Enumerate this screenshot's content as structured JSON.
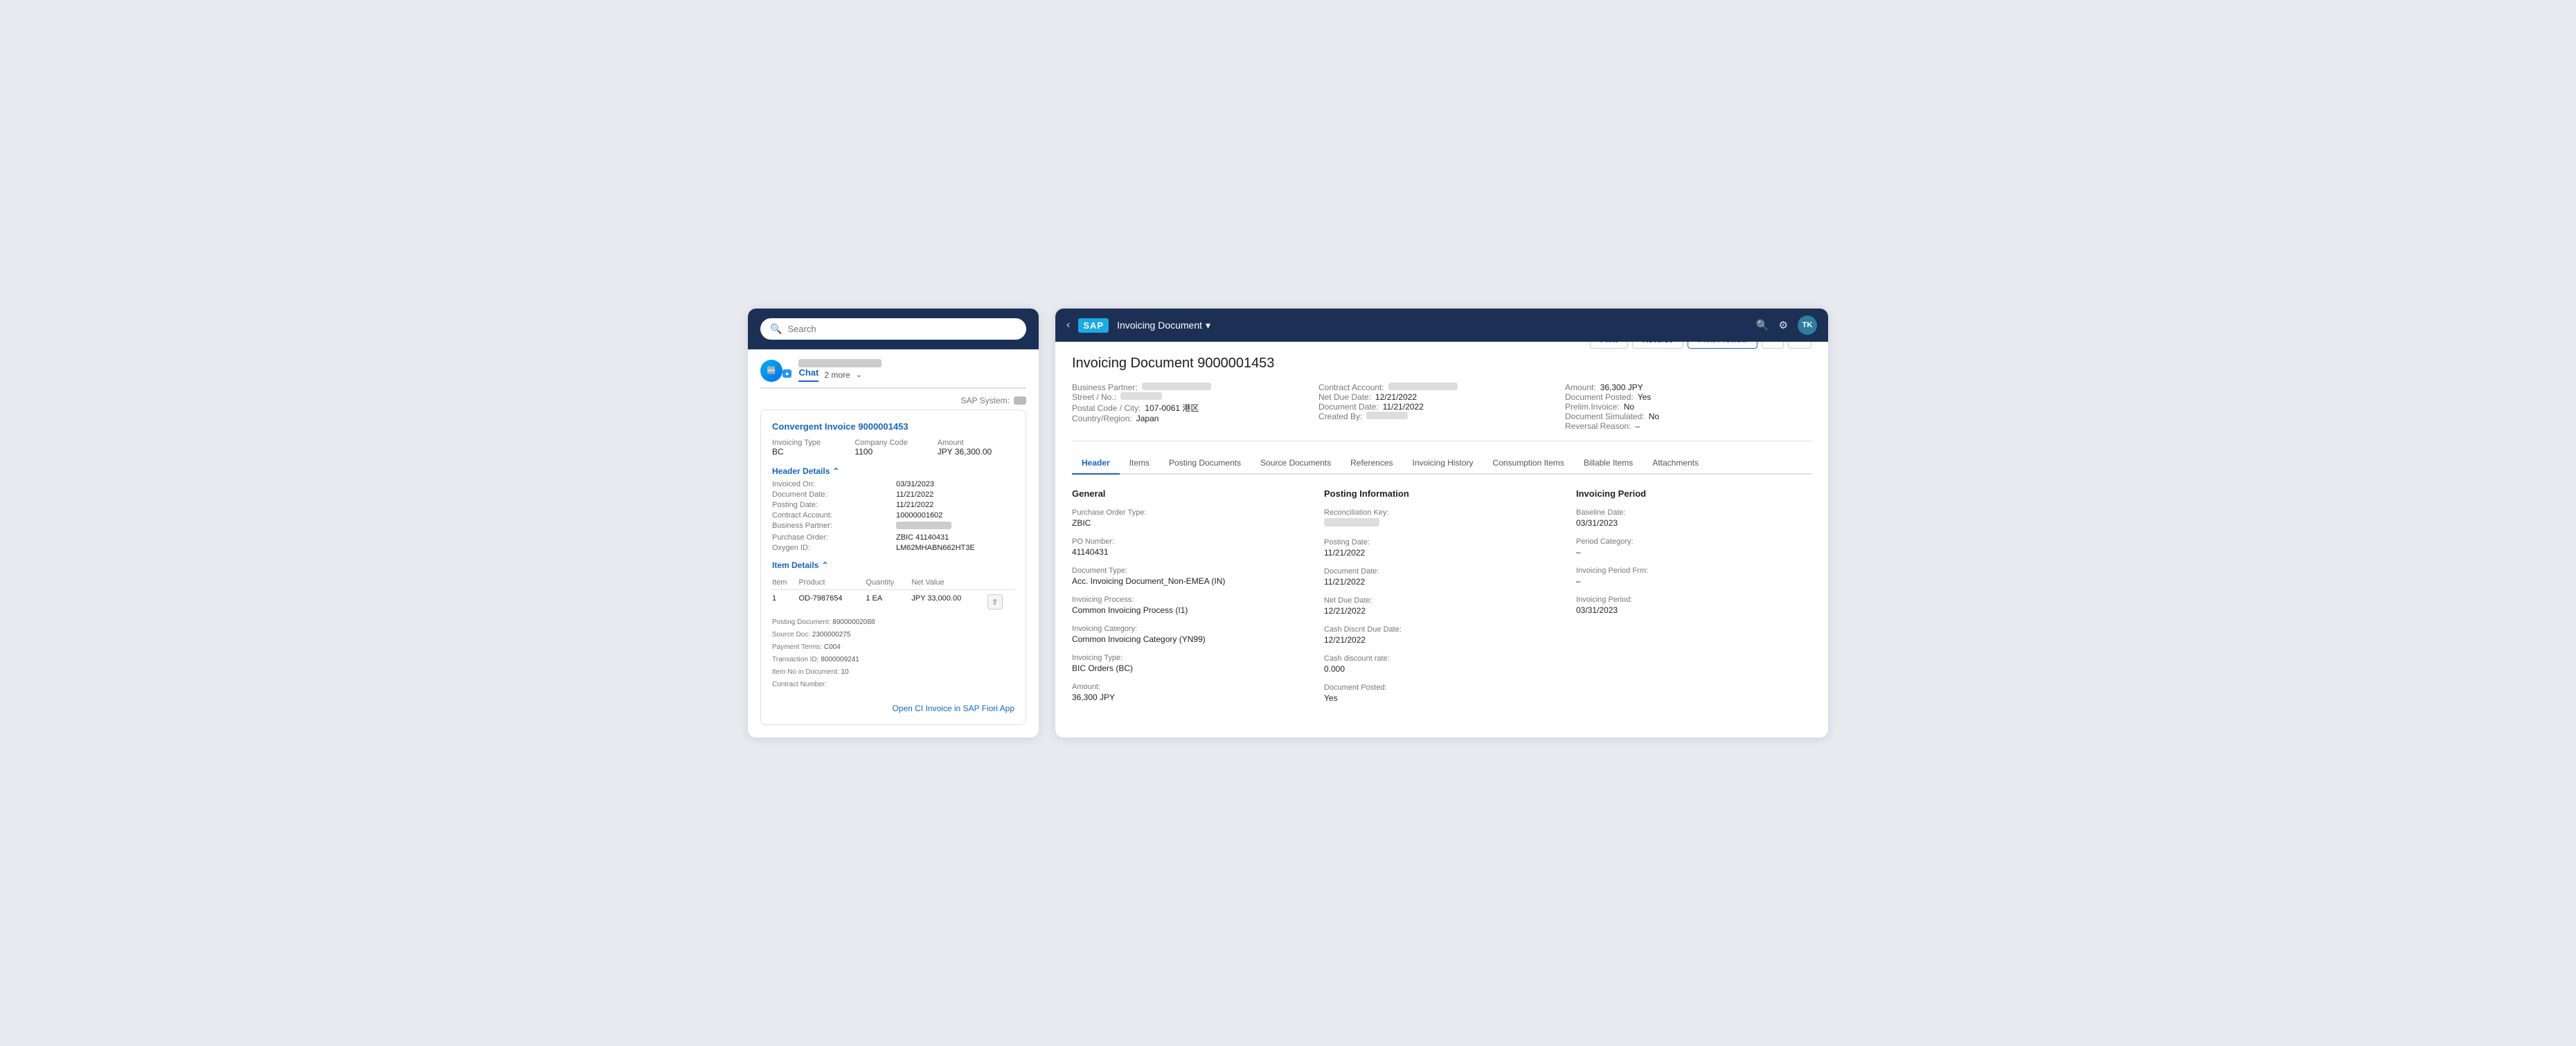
{
  "leftPanel": {
    "searchPlaceholder": "Search",
    "chatLabel": "Chat",
    "moreLabel": "2 more",
    "sapSystemLabel": "SAP System:",
    "invoiceLink": "Convergent Invoice 9000001453",
    "invoiceMeta": {
      "invTypeLabel": "Invoicing Type",
      "invTypeValue": "BC",
      "companyCodeLabel": "Company Code",
      "companyCodeValue": "1100",
      "amountLabel": "Amount",
      "amountValue": "JPY 36,300.00"
    },
    "headerDetails": {
      "sectionTitle": "Header Details",
      "fields": [
        {
          "label": "Invoiced On:",
          "value": "03/31/2023"
        },
        {
          "label": "Document Date:",
          "value": "11/21/2022"
        },
        {
          "label": "Posting Date:",
          "value": "11/21/2022"
        },
        {
          "label": "Contract Account:",
          "value": "10000001602"
        },
        {
          "label": "Business Partner:",
          "value": ""
        },
        {
          "label": "Purchase Order:",
          "value": "ZBIC 41140431"
        },
        {
          "label": "Oxygen ID:",
          "value": "LM62MHABN662HT3E"
        }
      ]
    },
    "itemDetails": {
      "sectionTitle": "Item Details",
      "tableHeaders": [
        "Item",
        "Product",
        "Quantity",
        "Net Value"
      ],
      "rows": [
        {
          "item": "1",
          "product": "OD-7987654",
          "quantity": "1 EA",
          "netValue": "JPY 33,000.00",
          "subFields": [
            {
              "label": "Posting Document:",
              "value": "89000002088"
            },
            {
              "label": "Source Doc:",
              "value": "2300000275"
            },
            {
              "label": "Payment Terms:",
              "value": "C004"
            },
            {
              "label": "Transaction ID:",
              "value": "8000009241"
            },
            {
              "label": "Item No in Document:",
              "value": "10"
            },
            {
              "label": "Contract Number:",
              "value": ""
            }
          ]
        }
      ]
    },
    "openLinkLabel": "Open CI Invoice in SAP Fiori App"
  },
  "rightPanel": {
    "topbar": {
      "logoText": "SAP",
      "appTitle": "Invoicing Document",
      "avatarLabel": "TK"
    },
    "docTitle": "Invoicing Document 9000001453",
    "actions": {
      "print": "Print",
      "reverse": "Reverse",
      "printPreview": "Print Preview"
    },
    "summary": {
      "businessPartnerLabel": "Business Partner:",
      "contractAccountLabel": "Contract Account:",
      "amountLabel": "Amount:",
      "amountValue": "36,300",
      "amountCurrency": "JPY",
      "documentPostedLabel": "Document Posted:",
      "documentPostedValue": "Yes",
      "streetNoLabel": "Street / No.:",
      "netDueDateLabel": "Net Due Date:",
      "netDueDateValue": "12/21/2022",
      "prelimInvoiceLabel": "Prelim.Invoice:",
      "prelimInvoiceValue": "No",
      "postalCityLabel": "Postal Code / City:",
      "postalCityValue": "107-0061 港区",
      "documentDateLabel": "Document Date:",
      "documentDateValue": "11/21/2022",
      "documentSimulatedLabel": "Document Simulated:",
      "documentSimulatedValue": "No",
      "countryLabel": "Country/Region:",
      "countryValue": "Japan",
      "createdByLabel": "Created By:",
      "reversalReasonLabel": "Reversal Reason:",
      "reversalReasonValue": "–"
    },
    "tabs": [
      {
        "id": "header",
        "label": "Header",
        "active": true
      },
      {
        "id": "items",
        "label": "Items"
      },
      {
        "id": "posting-documents",
        "label": "Posting Documents"
      },
      {
        "id": "source-documents",
        "label": "Source Documents"
      },
      {
        "id": "references",
        "label": "References"
      },
      {
        "id": "invoicing-history",
        "label": "Invoicing History"
      },
      {
        "id": "consumption-items",
        "label": "Consumption Items"
      },
      {
        "id": "billable-items",
        "label": "Billable Items"
      },
      {
        "id": "attachments",
        "label": "Attachments"
      }
    ],
    "sections": {
      "general": {
        "title": "General",
        "fields": [
          {
            "label": "Purchase Order Type:",
            "value": "ZBIC"
          },
          {
            "label": "PO Number:",
            "value": "41140431"
          },
          {
            "label": "Document Type:",
            "value": "Acc. Invoicing Document_Non-EMEA (IN)"
          },
          {
            "label": "Invoicing Process:",
            "value": "Common Invoicing Process (I1)"
          },
          {
            "label": "Invoicing Category:",
            "value": "Common Invoicing Category (YN99)"
          },
          {
            "label": "Invoicing Type:",
            "value": "BIC Orders (BC)"
          },
          {
            "label": "Amount:",
            "value": "36,300  JPY"
          }
        ]
      },
      "postingInformation": {
        "title": "Posting Information",
        "fields": [
          {
            "label": "Reconciliation Key:",
            "value": "blurred"
          },
          {
            "label": "Posting Date:",
            "value": "11/21/2022"
          },
          {
            "label": "Document Date:",
            "value": "11/21/2022"
          },
          {
            "label": "Net Due Date:",
            "value": "12/21/2022"
          },
          {
            "label": "Cash Discnt Due Date:",
            "value": "12/21/2022"
          },
          {
            "label": "Cash discount rate:",
            "value": "0.000"
          },
          {
            "label": "Document Posted:",
            "value": "Yes"
          }
        ]
      },
      "invoicingPeriod": {
        "title": "Invoicing Period",
        "fields": [
          {
            "label": "Baseline Date:",
            "value": "03/31/2023"
          },
          {
            "label": "Period Category:",
            "value": "–"
          },
          {
            "label": "Invoicing Period Frm:",
            "value": "–"
          },
          {
            "label": "Invoicing Period:",
            "value": "03/31/2023"
          }
        ]
      }
    }
  }
}
